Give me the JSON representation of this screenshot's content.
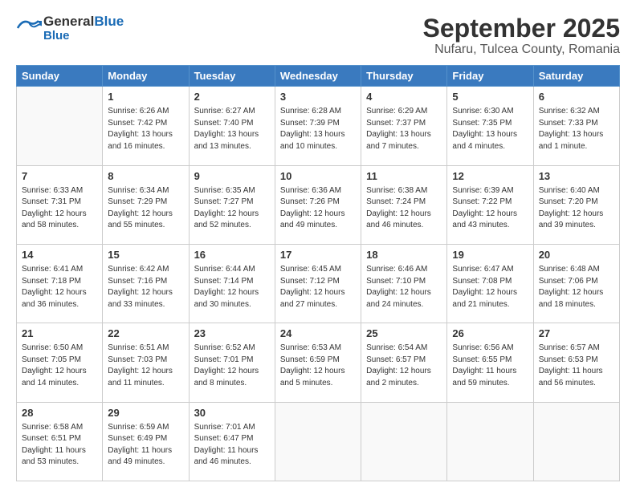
{
  "header": {
    "logo_general": "General",
    "logo_blue": "Blue",
    "title": "September 2025",
    "subtitle": "Nufaru, Tulcea County, Romania"
  },
  "weekdays": [
    "Sunday",
    "Monday",
    "Tuesday",
    "Wednesday",
    "Thursday",
    "Friday",
    "Saturday"
  ],
  "weeks": [
    [
      {
        "day": "",
        "sunrise": "",
        "sunset": "",
        "daylight": ""
      },
      {
        "day": "1",
        "sunrise": "Sunrise: 6:26 AM",
        "sunset": "Sunset: 7:42 PM",
        "daylight": "Daylight: 13 hours and 16 minutes."
      },
      {
        "day": "2",
        "sunrise": "Sunrise: 6:27 AM",
        "sunset": "Sunset: 7:40 PM",
        "daylight": "Daylight: 13 hours and 13 minutes."
      },
      {
        "day": "3",
        "sunrise": "Sunrise: 6:28 AM",
        "sunset": "Sunset: 7:39 PM",
        "daylight": "Daylight: 13 hours and 10 minutes."
      },
      {
        "day": "4",
        "sunrise": "Sunrise: 6:29 AM",
        "sunset": "Sunset: 7:37 PM",
        "daylight": "Daylight: 13 hours and 7 minutes."
      },
      {
        "day": "5",
        "sunrise": "Sunrise: 6:30 AM",
        "sunset": "Sunset: 7:35 PM",
        "daylight": "Daylight: 13 hours and 4 minutes."
      },
      {
        "day": "6",
        "sunrise": "Sunrise: 6:32 AM",
        "sunset": "Sunset: 7:33 PM",
        "daylight": "Daylight: 13 hours and 1 minute."
      }
    ],
    [
      {
        "day": "7",
        "sunrise": "Sunrise: 6:33 AM",
        "sunset": "Sunset: 7:31 PM",
        "daylight": "Daylight: 12 hours and 58 minutes."
      },
      {
        "day": "8",
        "sunrise": "Sunrise: 6:34 AM",
        "sunset": "Sunset: 7:29 PM",
        "daylight": "Daylight: 12 hours and 55 minutes."
      },
      {
        "day": "9",
        "sunrise": "Sunrise: 6:35 AM",
        "sunset": "Sunset: 7:27 PM",
        "daylight": "Daylight: 12 hours and 52 minutes."
      },
      {
        "day": "10",
        "sunrise": "Sunrise: 6:36 AM",
        "sunset": "Sunset: 7:26 PM",
        "daylight": "Daylight: 12 hours and 49 minutes."
      },
      {
        "day": "11",
        "sunrise": "Sunrise: 6:38 AM",
        "sunset": "Sunset: 7:24 PM",
        "daylight": "Daylight: 12 hours and 46 minutes."
      },
      {
        "day": "12",
        "sunrise": "Sunrise: 6:39 AM",
        "sunset": "Sunset: 7:22 PM",
        "daylight": "Daylight: 12 hours and 43 minutes."
      },
      {
        "day": "13",
        "sunrise": "Sunrise: 6:40 AM",
        "sunset": "Sunset: 7:20 PM",
        "daylight": "Daylight: 12 hours and 39 minutes."
      }
    ],
    [
      {
        "day": "14",
        "sunrise": "Sunrise: 6:41 AM",
        "sunset": "Sunset: 7:18 PM",
        "daylight": "Daylight: 12 hours and 36 minutes."
      },
      {
        "day": "15",
        "sunrise": "Sunrise: 6:42 AM",
        "sunset": "Sunset: 7:16 PM",
        "daylight": "Daylight: 12 hours and 33 minutes."
      },
      {
        "day": "16",
        "sunrise": "Sunrise: 6:44 AM",
        "sunset": "Sunset: 7:14 PM",
        "daylight": "Daylight: 12 hours and 30 minutes."
      },
      {
        "day": "17",
        "sunrise": "Sunrise: 6:45 AM",
        "sunset": "Sunset: 7:12 PM",
        "daylight": "Daylight: 12 hours and 27 minutes."
      },
      {
        "day": "18",
        "sunrise": "Sunrise: 6:46 AM",
        "sunset": "Sunset: 7:10 PM",
        "daylight": "Daylight: 12 hours and 24 minutes."
      },
      {
        "day": "19",
        "sunrise": "Sunrise: 6:47 AM",
        "sunset": "Sunset: 7:08 PM",
        "daylight": "Daylight: 12 hours and 21 minutes."
      },
      {
        "day": "20",
        "sunrise": "Sunrise: 6:48 AM",
        "sunset": "Sunset: 7:06 PM",
        "daylight": "Daylight: 12 hours and 18 minutes."
      }
    ],
    [
      {
        "day": "21",
        "sunrise": "Sunrise: 6:50 AM",
        "sunset": "Sunset: 7:05 PM",
        "daylight": "Daylight: 12 hours and 14 minutes."
      },
      {
        "day": "22",
        "sunrise": "Sunrise: 6:51 AM",
        "sunset": "Sunset: 7:03 PM",
        "daylight": "Daylight: 12 hours and 11 minutes."
      },
      {
        "day": "23",
        "sunrise": "Sunrise: 6:52 AM",
        "sunset": "Sunset: 7:01 PM",
        "daylight": "Daylight: 12 hours and 8 minutes."
      },
      {
        "day": "24",
        "sunrise": "Sunrise: 6:53 AM",
        "sunset": "Sunset: 6:59 PM",
        "daylight": "Daylight: 12 hours and 5 minutes."
      },
      {
        "day": "25",
        "sunrise": "Sunrise: 6:54 AM",
        "sunset": "Sunset: 6:57 PM",
        "daylight": "Daylight: 12 hours and 2 minutes."
      },
      {
        "day": "26",
        "sunrise": "Sunrise: 6:56 AM",
        "sunset": "Sunset: 6:55 PM",
        "daylight": "Daylight: 11 hours and 59 minutes."
      },
      {
        "day": "27",
        "sunrise": "Sunrise: 6:57 AM",
        "sunset": "Sunset: 6:53 PM",
        "daylight": "Daylight: 11 hours and 56 minutes."
      }
    ],
    [
      {
        "day": "28",
        "sunrise": "Sunrise: 6:58 AM",
        "sunset": "Sunset: 6:51 PM",
        "daylight": "Daylight: 11 hours and 53 minutes."
      },
      {
        "day": "29",
        "sunrise": "Sunrise: 6:59 AM",
        "sunset": "Sunset: 6:49 PM",
        "daylight": "Daylight: 11 hours and 49 minutes."
      },
      {
        "day": "30",
        "sunrise": "Sunrise: 7:01 AM",
        "sunset": "Sunset: 6:47 PM",
        "daylight": "Daylight: 11 hours and 46 minutes."
      },
      {
        "day": "",
        "sunrise": "",
        "sunset": "",
        "daylight": ""
      },
      {
        "day": "",
        "sunrise": "",
        "sunset": "",
        "daylight": ""
      },
      {
        "day": "",
        "sunrise": "",
        "sunset": "",
        "daylight": ""
      },
      {
        "day": "",
        "sunrise": "",
        "sunset": "",
        "daylight": ""
      }
    ]
  ]
}
